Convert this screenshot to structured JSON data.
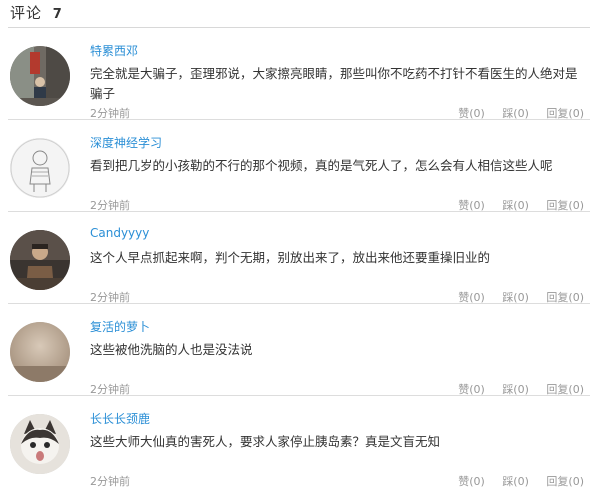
{
  "header": {
    "title": "评论",
    "count": "7"
  },
  "comments": [
    {
      "username": "特累西邓",
      "content": "完全就是大骗子，歪理邪说，大家擦亮眼睛，那些叫你不吃药不打针不看医生的人绝对是骗子",
      "time": "2分钟前",
      "like": "赞(0)",
      "dislike": "踩(0)",
      "reply": "回复(0)"
    },
    {
      "username": "深度神经学习",
      "content": "看到把几岁的小孩勒的不行的那个视频，真的是气死人了，怎么会有人相信这些人呢",
      "time": "2分钟前",
      "like": "赞(0)",
      "dislike": "踩(0)",
      "reply": "回复(0)"
    },
    {
      "username": "Candyyyy",
      "content": "这个人早点抓起来啊，判个无期，别放出来了，放出来他还要重操旧业的",
      "time": "2分钟前",
      "like": "赞(0)",
      "dislike": "踩(0)",
      "reply": "回复(0)"
    },
    {
      "username": "复活的萝卜",
      "content": "这些被他洗脑的人也是没法说",
      "time": "2分钟前",
      "like": "赞(0)",
      "dislike": "踩(0)",
      "reply": "回复(0)"
    },
    {
      "username": "长长长颈鹿",
      "content": "这些大师大仙真的害死人，要求人家停止胰岛素？真是文盲无知",
      "time": "2分钟前",
      "like": "赞(0)",
      "dislike": "踩(0)",
      "reply": "回复(0)"
    }
  ]
}
